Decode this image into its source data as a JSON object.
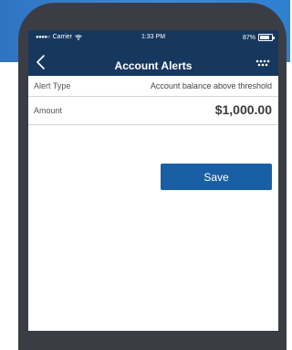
{
  "status_bar": {
    "carrier": "Carrier",
    "time": "1:33 PM",
    "battery": "87%",
    "battery_level": 0.87
  },
  "nav": {
    "title": "Account Alerts",
    "back_icon": "chevron-left-icon",
    "more_icon": "more-dots-icon"
  },
  "form": {
    "alert_type": {
      "label": "Alert Type",
      "value": "Account balance above threshold"
    },
    "amount": {
      "label": "Amount",
      "value": "$1,000.00"
    }
  },
  "actions": {
    "save_label": "Save"
  },
  "colors": {
    "nav_background": "#16385f",
    "accent": "#1a5fa3",
    "backdrop": "#3a8ad8",
    "phone_frame": "#3a3d44"
  }
}
